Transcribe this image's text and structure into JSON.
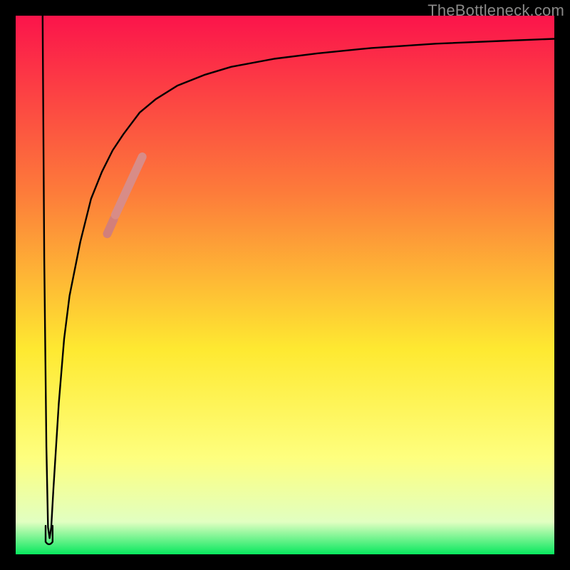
{
  "watermark": "TheBottleneck.com",
  "colors": {
    "top": "#fb144b",
    "mid_upper": "#fd7c3a",
    "mid": "#fee931",
    "mid_lower": "#feff7e",
    "near_bottom": "#e1ffc1",
    "bottom": "#08e85e",
    "frame": "#000000",
    "curve": "#000000",
    "highlight": "#d88c87",
    "highlight2": "#d27f7a"
  },
  "chart_data": {
    "type": "line",
    "title": "",
    "xlabel": "",
    "ylabel": "",
    "xlim": [
      0,
      100
    ],
    "ylim": [
      0,
      100
    ],
    "series": [
      {
        "name": "curve",
        "x": [
          5,
          5.3,
          5.7,
          6.0,
          6.3,
          6.6,
          7.0,
          7.5,
          8.0,
          9.0,
          10.0,
          12.0,
          14.0,
          16.0,
          18.0,
          20.0,
          23.0,
          26.0,
          30.0,
          35.0,
          40.0,
          48.0,
          56.0,
          66.0,
          78.0,
          90.0,
          100.0
        ],
        "y": [
          100,
          55,
          20,
          5,
          3,
          5,
          12,
          20,
          28,
          40,
          48,
          58,
          66,
          71,
          75,
          78,
          82,
          84.5,
          87,
          89,
          90.5,
          92,
          93,
          94,
          94.8,
          95.3,
          95.7
        ]
      }
    ],
    "highlight_segments": [
      {
        "x0": 18.5,
        "y0": 63.0,
        "x1": 23.5,
        "y1": 73.8
      },
      {
        "x0": 17.0,
        "y0": 59.5,
        "x1": 18.2,
        "y1": 62.2
      }
    ],
    "notch": {
      "x": 6.2,
      "y_bottom": 1.8,
      "width": 1.3,
      "height": 3.5
    }
  }
}
